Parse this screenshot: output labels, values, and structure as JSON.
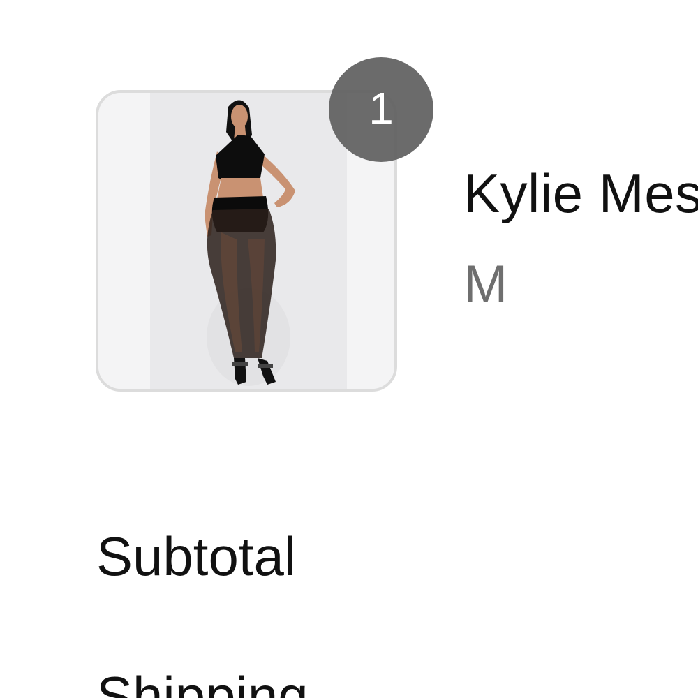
{
  "cart_item": {
    "quantity": "1",
    "name": "Kylie Mesh Skirt Set",
    "variant": "M",
    "image_icon": "product-photo"
  },
  "summary": {
    "subtotal_label": "Subtotal",
    "shipping_label": "Shipping"
  },
  "colors": {
    "badge": "#606060",
    "variant_text": "#6f6f6f",
    "thumb_border": "#dcdcdc"
  }
}
